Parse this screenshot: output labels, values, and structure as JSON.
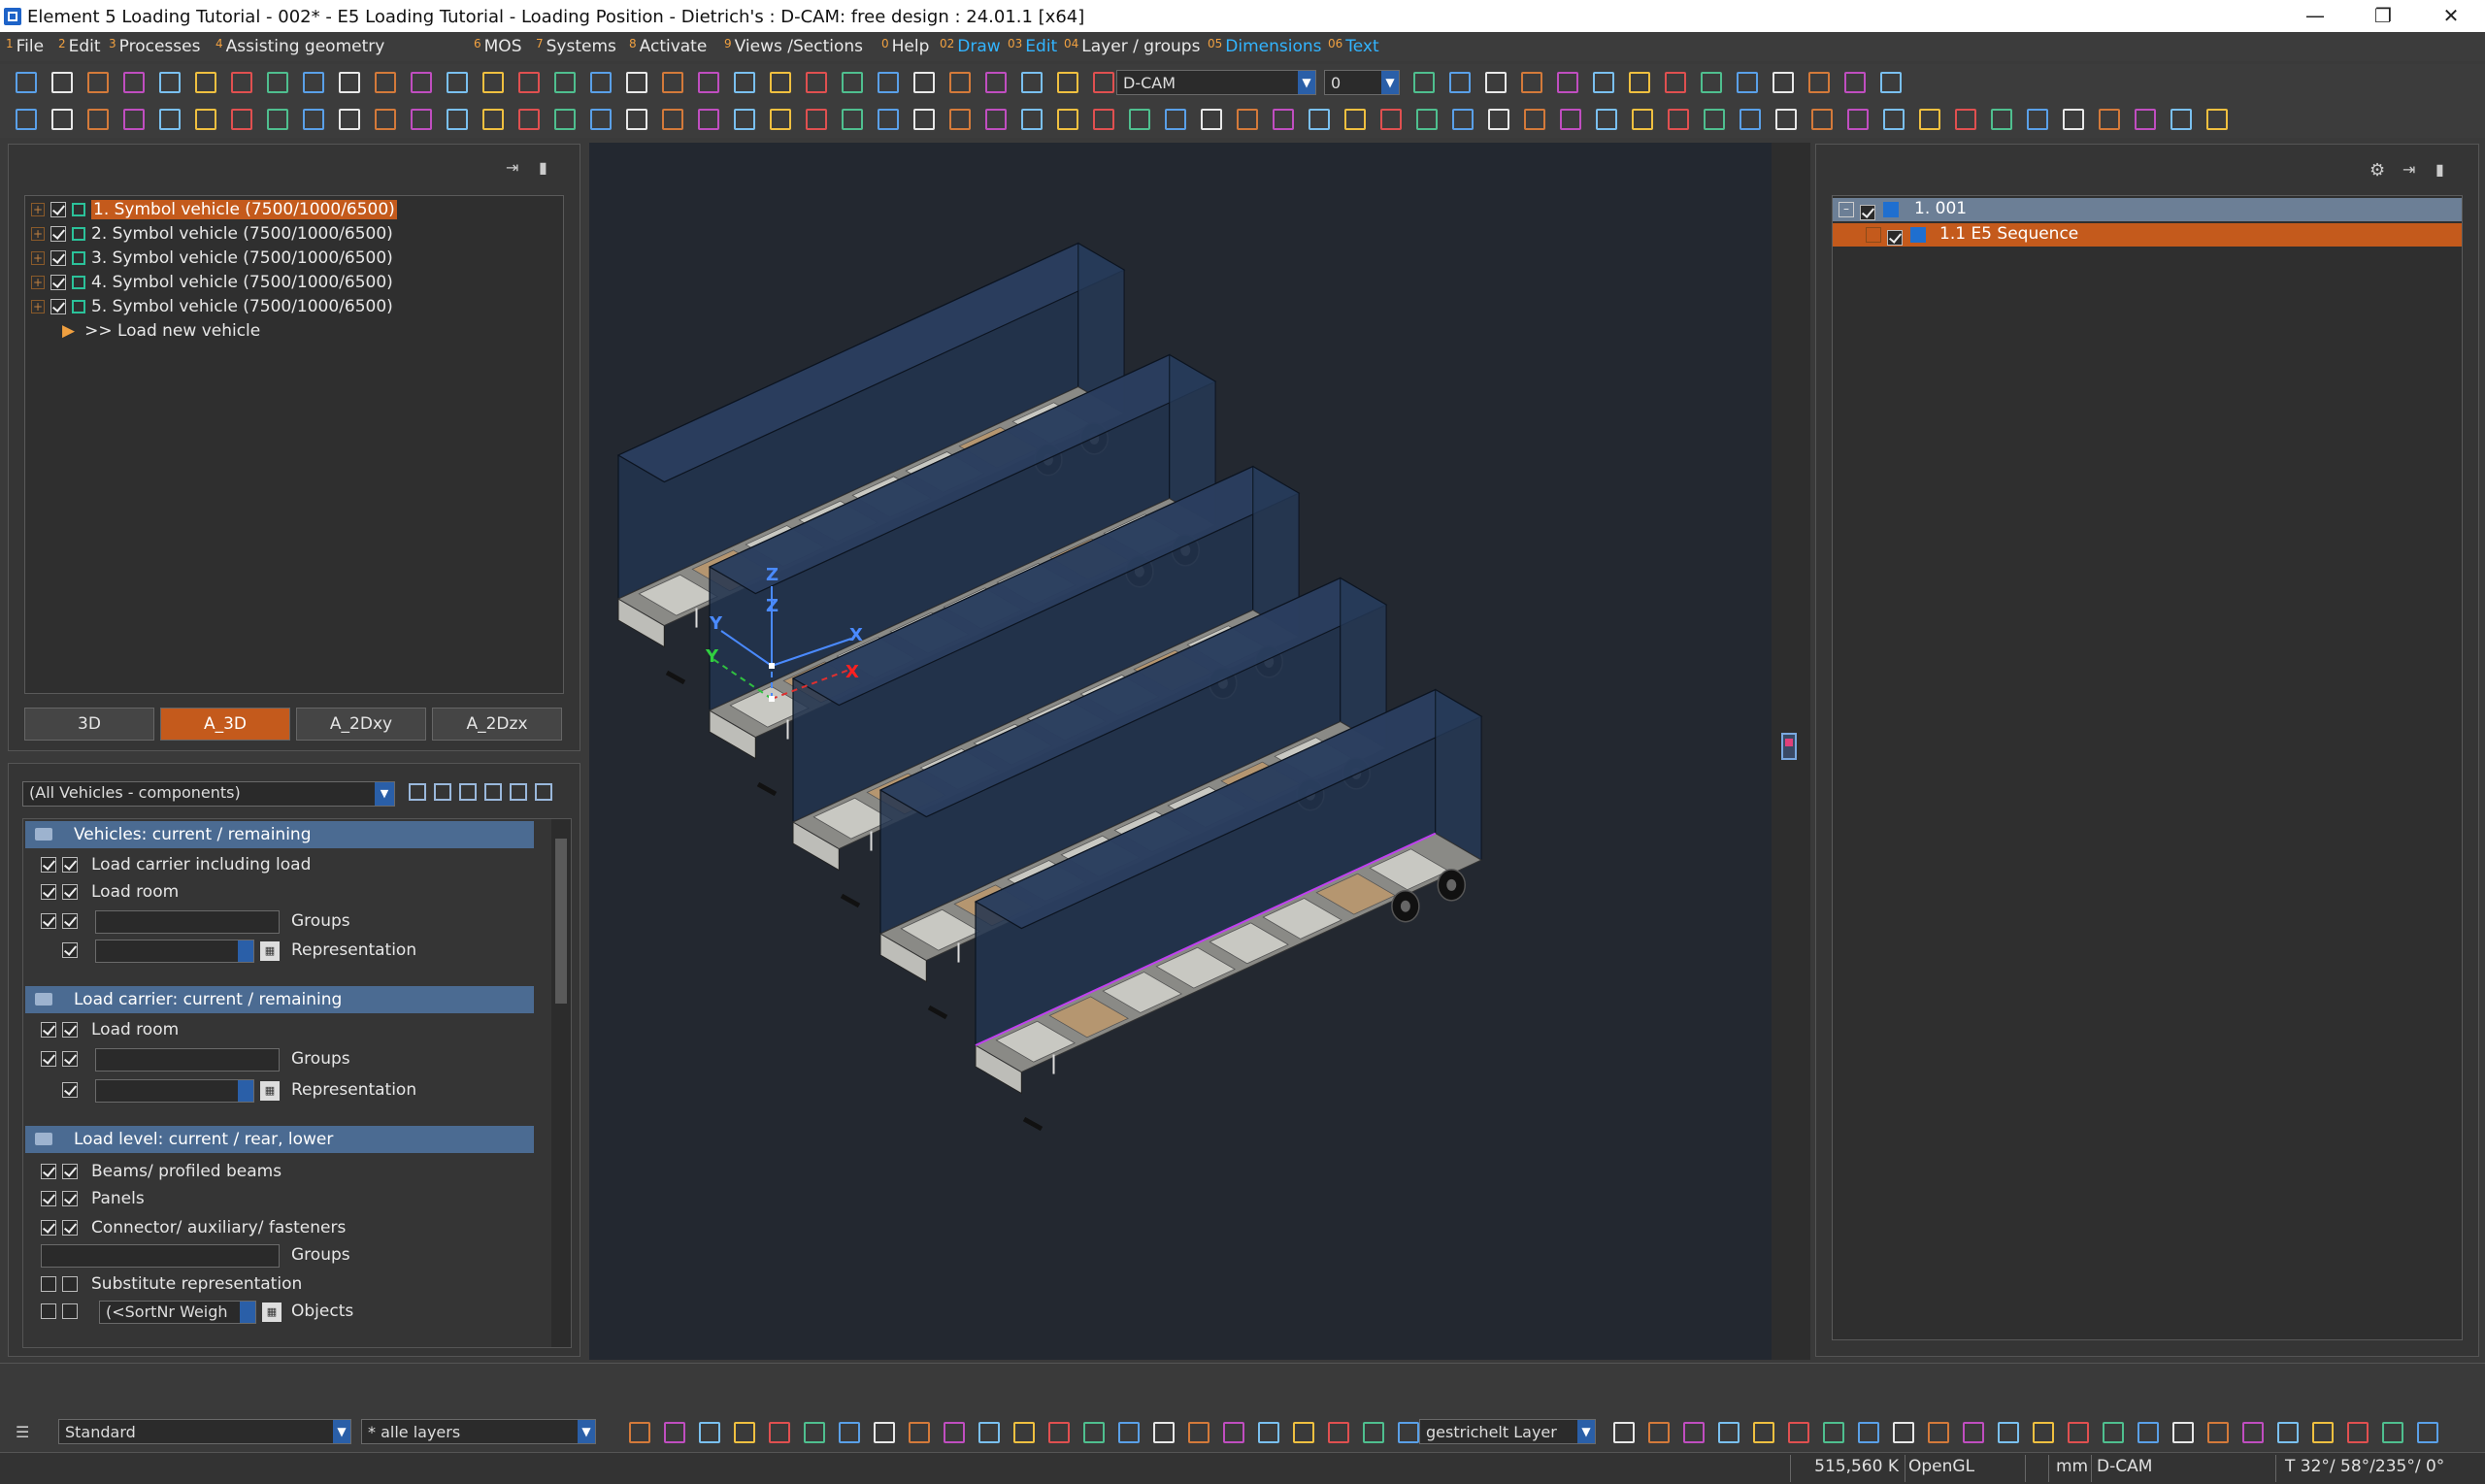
{
  "window": {
    "title": "Element 5 Loading Tutorial - 002* - E5 Loading Tutorial - Loading Position  - Dietrich's : D-CAM: free design : 24.01.1 [x64]"
  },
  "menu": [
    {
      "num": "1",
      "label": "File"
    },
    {
      "num": "2",
      "label": "Edit"
    },
    {
      "num": "3",
      "label": "Processes"
    },
    {
      "num": "4",
      "label": "Assisting geometry"
    },
    {
      "num": "6",
      "label": "MOS"
    },
    {
      "num": "7",
      "label": "Systems"
    },
    {
      "num": "8",
      "label": "Activate"
    },
    {
      "num": "9",
      "label": "Views /Sections"
    },
    {
      "num": "0",
      "label": "Help"
    },
    {
      "num": "02",
      "label": "Draw"
    },
    {
      "num": "03",
      "label": "Edit"
    },
    {
      "num": "04",
      "label": "Layer / groups"
    },
    {
      "num": "05",
      "label": "Dimensions"
    },
    {
      "num": "06",
      "label": "Text"
    }
  ],
  "toolbar": {
    "view_combo": "D-CAM",
    "layer_number": "0"
  },
  "vehicle_tree": {
    "items": [
      "1. Symbol vehicle (7500/1000/6500)",
      "2. Symbol vehicle (7500/1000/6500)",
      "3. Symbol vehicle (7500/1000/6500)",
      "4. Symbol vehicle (7500/1000/6500)",
      "5. Symbol vehicle (7500/1000/6500)"
    ],
    "load_new": ">> Load new vehicle"
  },
  "view_tabs": [
    "3D",
    "A_3D",
    "A_2Dxy",
    "A_2Dzx"
  ],
  "active_view_tab": "A_3D",
  "filter_combo": "(All Vehicles - components)",
  "sections": {
    "vehicles": {
      "header": "Vehicles: current / remaining",
      "rows": [
        "Load carrier including load",
        "Load room"
      ],
      "groups": "Groups",
      "representation": "Representation"
    },
    "load_carrier": {
      "header": "Load carrier: current / remaining",
      "rows": [
        "Load room"
      ],
      "groups": "Groups",
      "representation": "Representation"
    },
    "load_level": {
      "header": "Load level: current / rear, lower",
      "rows": [
        "Beams/ profiled beams",
        "Panels",
        "Connector/ auxiliary/ fasteners"
      ],
      "groups": "Groups",
      "substitute": "Substitute representation",
      "sort_value": "(<SortNr Weigh",
      "objects": "Objects"
    }
  },
  "right_tree": {
    "root": "1. 001",
    "child": "1.1 E5 Sequence"
  },
  "axes": {
    "x": "X",
    "y": "Y",
    "z": "Z"
  },
  "bottom": {
    "standard_combo": "Standard",
    "layers_combo": "* alle layers",
    "linetype_combo": "gestrichelt Layer"
  },
  "status": {
    "coords": "515,560 K",
    "renderer": "OpenGL",
    "unit": "mm",
    "mode": "D-CAM",
    "angles": "T 32°/ 58°/235°/  0°"
  },
  "colors": {
    "accent_orange": "#c45a1c",
    "section_blue": "#4b6b92",
    "viewport_bg": "#232830"
  }
}
